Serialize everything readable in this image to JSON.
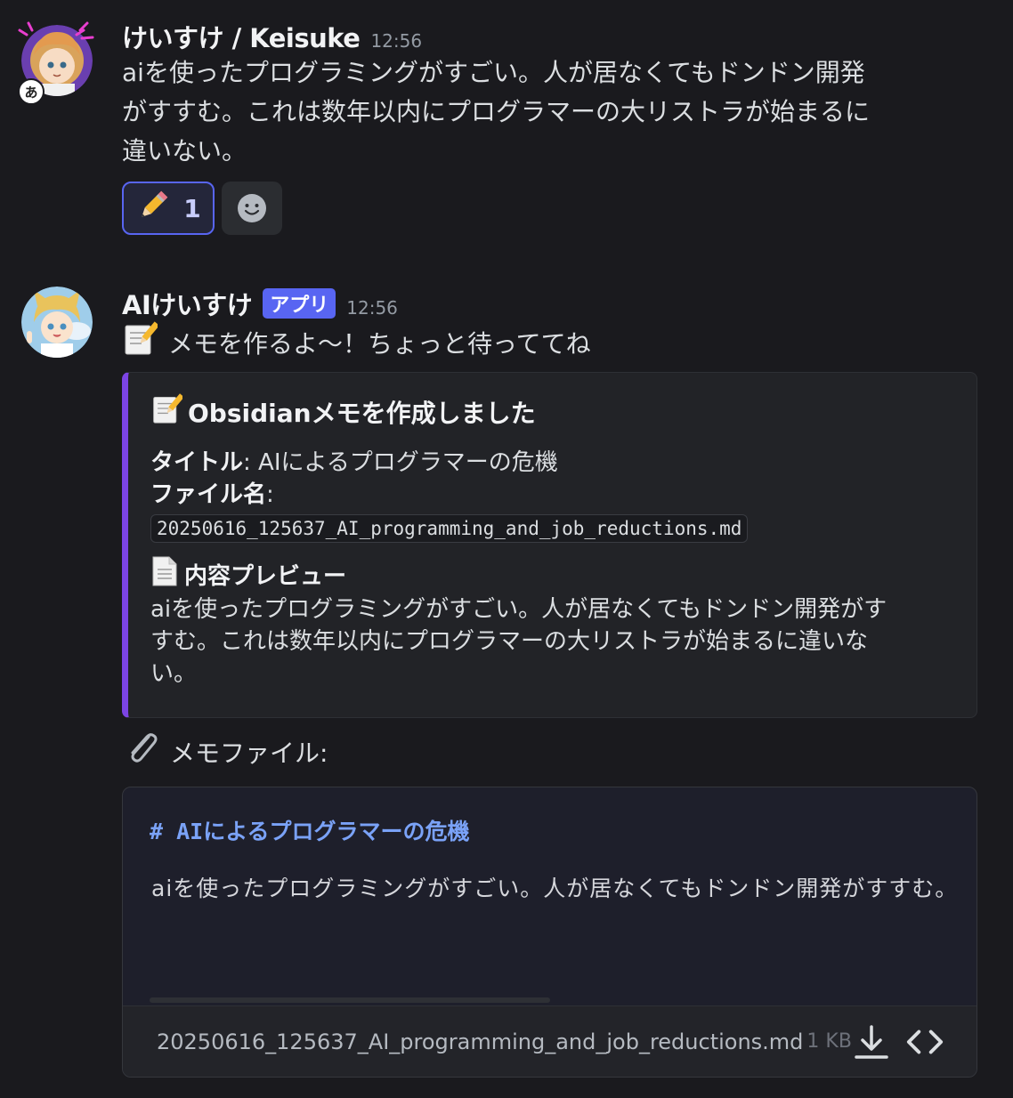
{
  "messages": [
    {
      "username": "けいすけ / Keisuke",
      "timestamp": "12:56",
      "avatar_badge": "あ",
      "lines": [
        "aiを使ったプログラミングがすごい。人が居なくてもドンドン開発",
        "がすすむ。これは数年以内にプログラマーの大リストラが始まるに",
        "違いない。"
      ],
      "reactions": [
        {
          "emoji": "✏️",
          "count": "1"
        }
      ]
    },
    {
      "username": "AIけいすけ",
      "badge": "アプリ",
      "timestamp": "12:56",
      "intro": "メモを作るよ〜！ちょっと待っててね",
      "attachment_label": "メモファイル:"
    }
  ],
  "embed": {
    "title": "Obsidianメモを作成しました",
    "title_field_label": "タイトル",
    "title_field_value": ": AIによるプログラマーの危機",
    "file_field_label": "ファイル名",
    "file_field_colon": ":",
    "file_name_code": "20250616_125637_AI_programming_and_job_reductions.md",
    "preview_title": "内容プレビュー",
    "preview_lines": [
      "aiを使ったプログラミングがすごい。人が居なくてもドンドン開発がす",
      "すむ。これは数年以内にプログラマーの大リストラが始まるに違いな",
      "い。"
    ]
  },
  "file_card": {
    "heading": "# AIによるプログラマーの危機",
    "body": "aiを使ったプログラミングがすごい。人が居なくてもドンドン開発がすすむ。",
    "file_name": "20250616_125637_AI_programming_and_job_reductions.md",
    "file_size": "1 KB"
  },
  "colors": {
    "accent": "#5865f2",
    "embed_bar": "#7c44e4",
    "heading_blue": "#7aa2f7"
  }
}
